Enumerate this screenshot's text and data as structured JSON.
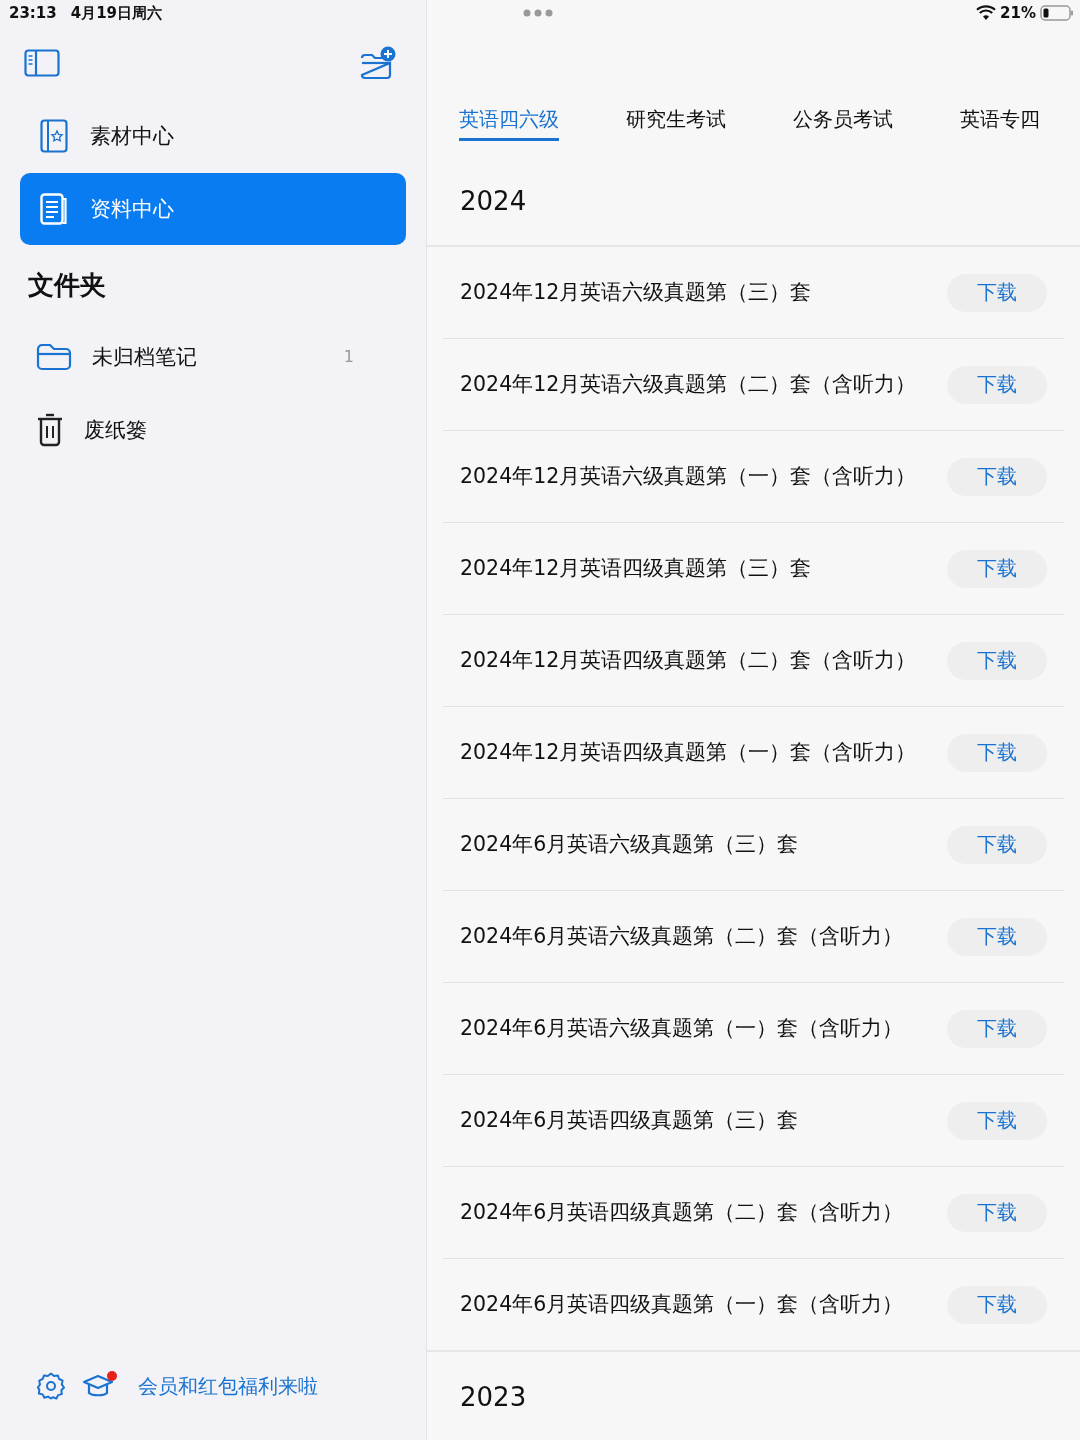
{
  "status_bar": {
    "time": "23:13",
    "date": "4月19日周六",
    "battery": "21%"
  },
  "sidebar": {
    "items": [
      {
        "label": "素材中心",
        "kind": "book",
        "selected": false
      },
      {
        "label": "资料中心",
        "kind": "document",
        "selected": true
      }
    ],
    "folders_title": "文件夹",
    "folders": [
      {
        "label": "未归档笔记",
        "kind": "folder",
        "count": "1"
      },
      {
        "label": "废纸篓",
        "kind": "trash"
      }
    ],
    "promo": "会员和红包福利来啦"
  },
  "tabs": [
    {
      "label": "英语四六级",
      "selected": true
    },
    {
      "label": "研究生考试",
      "selected": false
    },
    {
      "label": "公务员考试",
      "selected": false
    },
    {
      "label": "英语专四",
      "selected": false
    }
  ],
  "sections": [
    {
      "year": "2024",
      "rows": [
        {
          "title": "2024年12月英语六级真题第（三）套",
          "action": "下载"
        },
        {
          "title": "2024年12月英语六级真题第（二）套（含听力）",
          "action": "下载"
        },
        {
          "title": "2024年12月英语六级真题第（一）套（含听力）",
          "action": "下载"
        },
        {
          "title": "2024年12月英语四级真题第（三）套",
          "action": "下载"
        },
        {
          "title": "2024年12月英语四级真题第（二）套（含听力）",
          "action": "下载"
        },
        {
          "title": "2024年12月英语四级真题第（一）套（含听力）",
          "action": "下载"
        },
        {
          "title": "2024年6月英语六级真题第（三）套",
          "action": "下载"
        },
        {
          "title": "2024年6月英语六级真题第（二）套（含听力）",
          "action": "下载"
        },
        {
          "title": "2024年6月英语六级真题第（一）套（含听力）",
          "action": "下载"
        },
        {
          "title": "2024年6月英语四级真题第（三）套",
          "action": "下载"
        },
        {
          "title": "2024年6月英语四级真题第（二）套（含听力）",
          "action": "下载"
        },
        {
          "title": "2024年6月英语四级真题第（一）套（含听力）",
          "action": "下载"
        }
      ]
    },
    {
      "year": "2023"
    }
  ]
}
